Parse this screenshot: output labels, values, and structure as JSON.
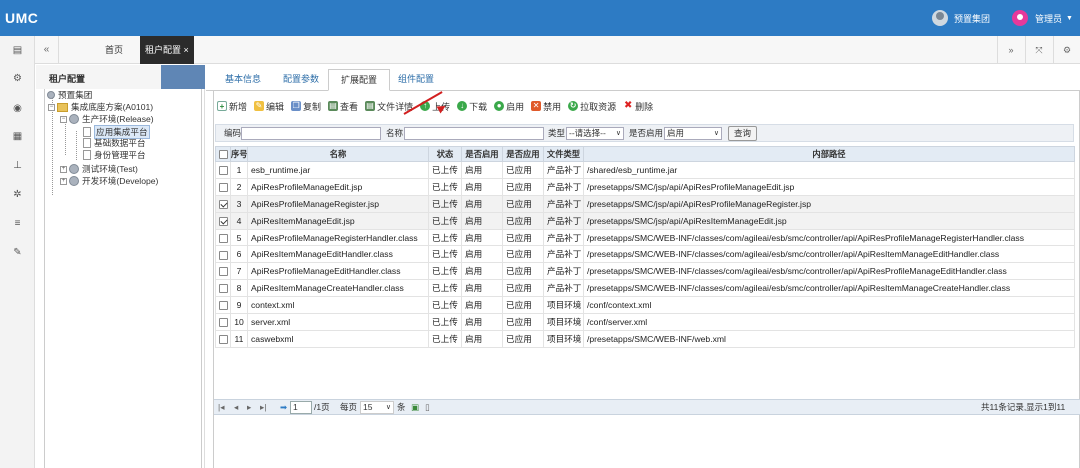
{
  "app": {
    "title": "UMC"
  },
  "header": {
    "org_label": "预置集团",
    "user_label": "管理员"
  },
  "tabs": {
    "home": "首页",
    "active": "租户配置 ×"
  },
  "tree": {
    "header": "租户配置",
    "nodes": [
      "预置集团",
      "集成底座方案(A0101)",
      "生产环境(Release)",
      "应用集成平台",
      "基础数据平台",
      "身份管理平台",
      "测试环境(Test)",
      "开发环境(Develope)"
    ]
  },
  "subtabs": [
    "基本信息",
    "配置参数",
    "扩展配置",
    "组件配置"
  ],
  "toolbar": {
    "add": "新增",
    "edit": "编辑",
    "copy": "复制",
    "view": "查看",
    "detail": "文件详情",
    "upload": "上传",
    "download": "下载",
    "enable": "启用",
    "disable": "禁用",
    "pull": "拉取资源",
    "delete": "删除"
  },
  "search": {
    "code_label": "编码",
    "name_label": "名称",
    "type_label": "类型",
    "type_value": "--请选择--",
    "enabled_label": "是否启用",
    "enabled_value": "启用",
    "query_button": "查询"
  },
  "table": {
    "headers": [
      "序号",
      "名称",
      "状态",
      "是否启用",
      "是否应用",
      "文件类型",
      "内部路径"
    ],
    "rows": [
      {
        "checked": false,
        "no": "1",
        "name": "esb_runtime.jar",
        "status": "已上传",
        "enabled": "启用",
        "applied": "已应用",
        "type": "产品补丁",
        "path": "/shared/esb_runtime.jar"
      },
      {
        "checked": false,
        "no": "2",
        "name": "ApiResProfileManageEdit.jsp",
        "status": "已上传",
        "enabled": "启用",
        "applied": "已应用",
        "type": "产品补丁",
        "path": "/presetapps/SMC/jsp/api/ApiResProfileManageEdit.jsp"
      },
      {
        "checked": true,
        "no": "3",
        "name": "ApiResProfileManageRegister.jsp",
        "status": "已上传",
        "enabled": "启用",
        "applied": "已应用",
        "type": "产品补丁",
        "path": "/presetapps/SMC/jsp/api/ApiResProfileManageRegister.jsp"
      },
      {
        "checked": true,
        "no": "4",
        "name": "ApiResItemManageEdit.jsp",
        "status": "已上传",
        "enabled": "启用",
        "applied": "已应用",
        "type": "产品补丁",
        "path": "/presetapps/SMC/jsp/api/ApiResItemManageEdit.jsp"
      },
      {
        "checked": false,
        "no": "5",
        "name": "ApiResProfileManageRegisterHandler.class",
        "status": "已上传",
        "enabled": "启用",
        "applied": "已应用",
        "type": "产品补丁",
        "path": "/presetapps/SMC/WEB-INF/classes/com/agileai/esb/smc/controller/api/ApiResProfileManageRegisterHandler.class"
      },
      {
        "checked": false,
        "no": "6",
        "name": "ApiResItemManageEditHandler.class",
        "status": "已上传",
        "enabled": "启用",
        "applied": "已应用",
        "type": "产品补丁",
        "path": "/presetapps/SMC/WEB-INF/classes/com/agileai/esb/smc/controller/api/ApiResItemManageEditHandler.class"
      },
      {
        "checked": false,
        "no": "7",
        "name": "ApiResProfileManageEditHandler.class",
        "status": "已上传",
        "enabled": "启用",
        "applied": "已应用",
        "type": "产品补丁",
        "path": "/presetapps/SMC/WEB-INF/classes/com/agileai/esb/smc/controller/api/ApiResProfileManageEditHandler.class"
      },
      {
        "checked": false,
        "no": "8",
        "name": "ApiResItemManageCreateHandler.class",
        "status": "已上传",
        "enabled": "启用",
        "applied": "已应用",
        "type": "产品补丁",
        "path": "/presetapps/SMC/WEB-INF/classes/com/agileai/esb/smc/controller/api/ApiResItemManageCreateHandler.class"
      },
      {
        "checked": false,
        "no": "9",
        "name": "context.xml",
        "status": "已上传",
        "enabled": "启用",
        "applied": "已应用",
        "type": "项目环境",
        "path": "/conf/context.xml"
      },
      {
        "checked": false,
        "no": "10",
        "name": "server.xml",
        "status": "已上传",
        "enabled": "启用",
        "applied": "已应用",
        "type": "项目环境",
        "path": "/conf/server.xml"
      },
      {
        "checked": false,
        "no": "11",
        "name": "caswebxml",
        "status": "已上传",
        "enabled": "启用",
        "applied": "已应用",
        "type": "项目环境",
        "path": "/presetapps/SMC/WEB-INF/web.xml"
      }
    ]
  },
  "pager": {
    "page_value": "1",
    "page_total": "/1页",
    "per_page_label": "每页",
    "per_page_value": "15",
    "per_page_unit": "条",
    "summary": "共11条记录,显示1到11"
  },
  "colors": {
    "brand": "#2d7bc4",
    "tree_accent": "#5f86b5",
    "annotation_arrow": "#d21f1f"
  }
}
